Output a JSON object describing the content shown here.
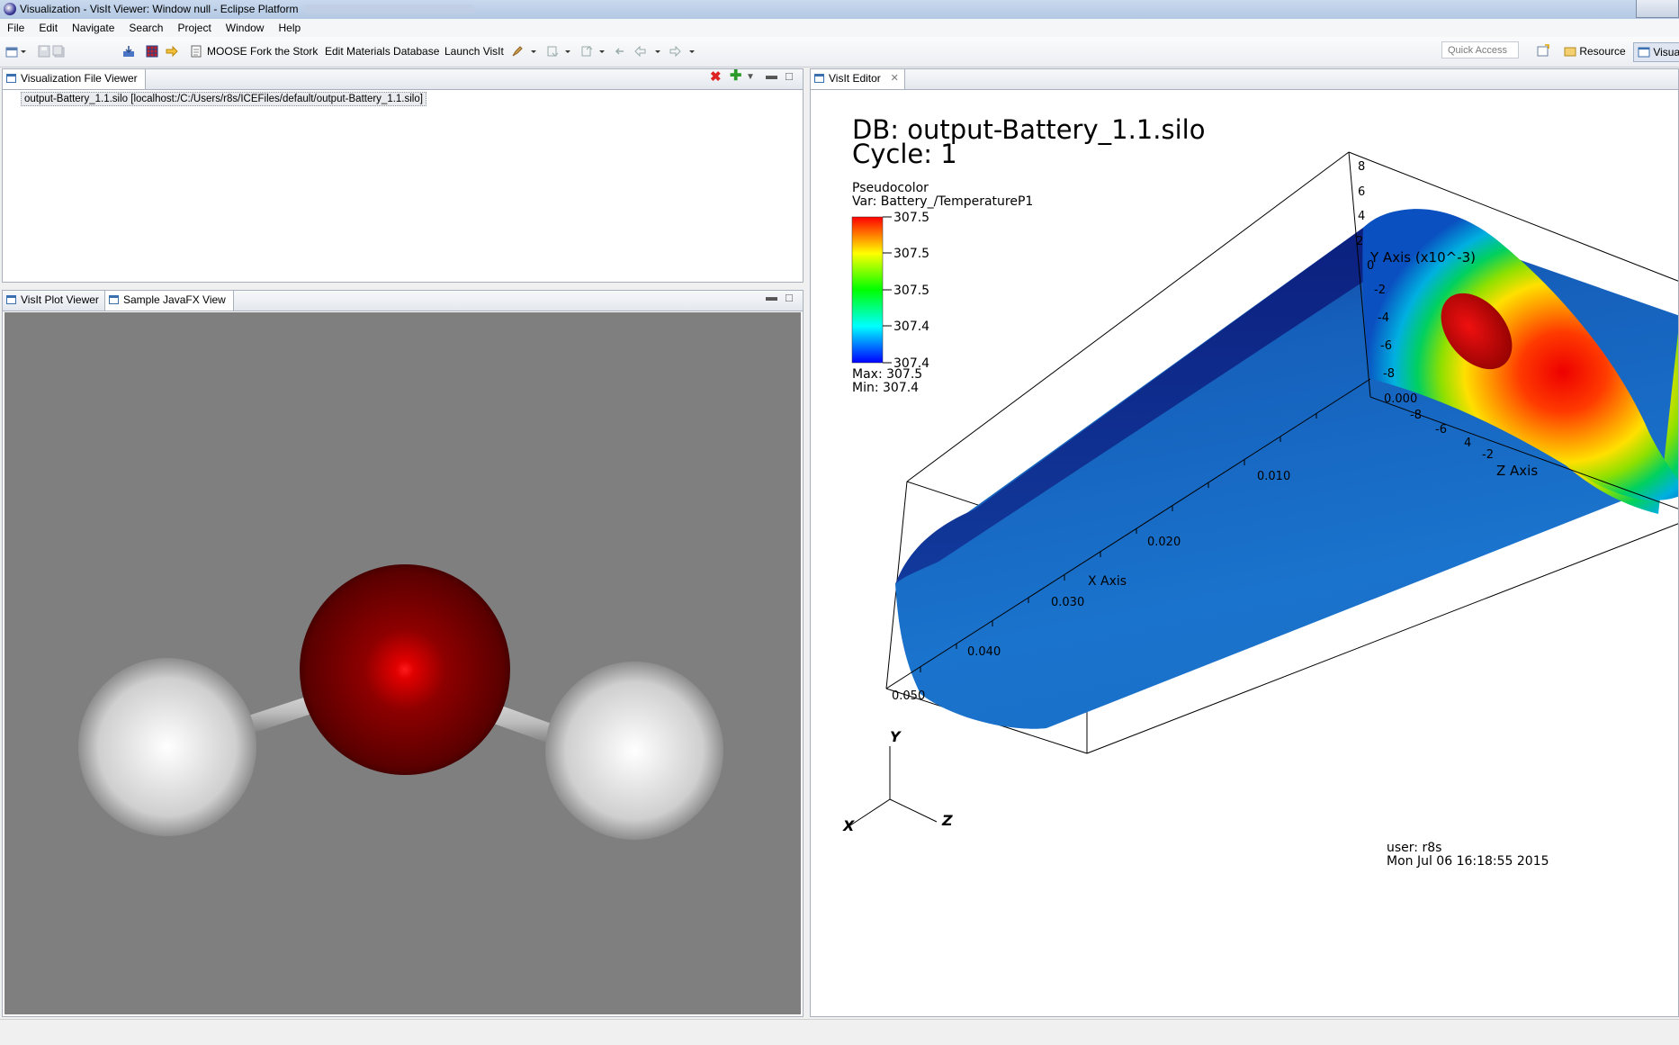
{
  "window": {
    "title": "Visualization - VisIt Viewer: Window null - Eclipse Platform"
  },
  "menu": [
    "File",
    "Edit",
    "Navigate",
    "Search",
    "Project",
    "Window",
    "Help"
  ],
  "toolbar": {
    "moose_label": "MOOSE Fork the Stork",
    "materials_label": "Edit Materials Database",
    "launch_visit_label": "Launch VisIt",
    "quick_access_placeholder": "Quick Access",
    "perspective_resource": "Resource",
    "perspective_visualization": "Visua"
  },
  "file_viewer": {
    "tab_label": "Visualization File Viewer",
    "entries": [
      "output-Battery_1.1.silo [localhost:/C:/Users/r8s/ICEFiles/default/output-Battery_1.1.silo]"
    ]
  },
  "plot_viewer": {
    "tabs": [
      "VisIt Plot Viewer",
      "Sample JavaFX View"
    ]
  },
  "visit_editor": {
    "tab_label": "VisIt Editor",
    "db_line": "DB: output-Battery_1.1.silo",
    "cycle_line": "Cycle: 1",
    "legend": {
      "plot_type": "Pseudocolor",
      "var_line": "Var: Battery_/TemperatureP1",
      "ticks": [
        "307.5",
        "307.5",
        "307.5",
        "307.4",
        "307.4"
      ],
      "max_line": "Max:  307.5",
      "min_line": "Min:  307.4"
    },
    "x_axis_label": "X Axis",
    "x_ticks": [
      "0.000",
      "0.010",
      "0.020",
      "0.030",
      "0.040",
      "0.050"
    ],
    "y_axis_label": "Y Axis (x10^-3)",
    "y_ticks": [
      "8",
      "6",
      "4",
      "2",
      "0",
      "-2",
      "-4",
      "-6",
      "-8"
    ],
    "z_axis_label": "Z Axis",
    "z_ticks": [
      "-8",
      "-6",
      "4",
      "-2"
    ],
    "triad": {
      "x": "X",
      "y": "Y",
      "z": "Z"
    },
    "user_line": "user: r8s",
    "date_line": "Mon Jul 06 16:18:55 2015"
  },
  "colors": {
    "fx_background": "#7f7f7f",
    "oxygen": "#8b0000",
    "hydrogen": "#e8e8e8"
  }
}
